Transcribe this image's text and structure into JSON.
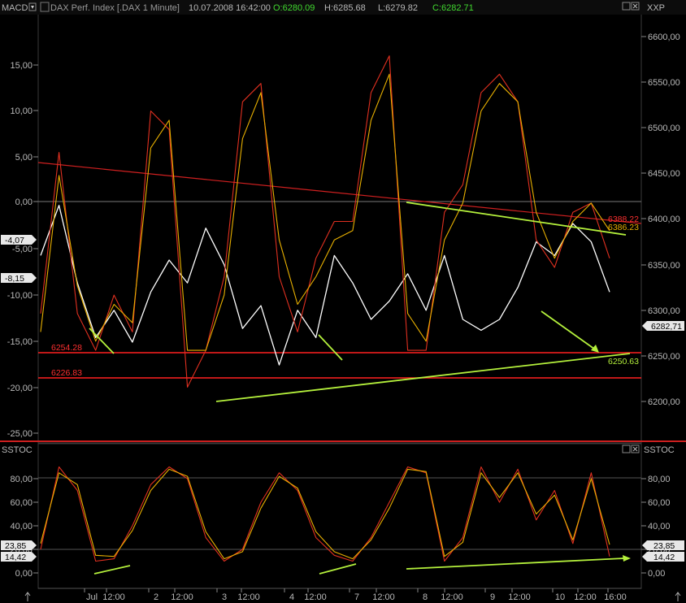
{
  "main_panel": {
    "left_title": "MACD",
    "right_title": "XXP",
    "instrument": "DAX Perf. Index [.DAX  1 Minute]",
    "datetime": "10.07.2008 16:42:00",
    "open": "O:6280.09",
    "high": "H:6285.68",
    "low": "L:6279.82",
    "close": "C:6282.71",
    "left_axis_ticks": [
      "15,00",
      "10,00",
      "5,00",
      "0,00",
      "-5,00",
      "-10,00",
      "-15,00",
      "-20,00",
      "-25,00"
    ],
    "right_axis_ticks": [
      "6600,00",
      "6550,00",
      "6500,00",
      "6450,00",
      "6400,00",
      "6350,00",
      "6300,00",
      "6250,00",
      "6200,00"
    ],
    "macd_tag_1": "-4,07",
    "macd_tag_2": "-8,15",
    "price_tag": "6282,71",
    "level_1": "6254.28",
    "level_2": "6226.83",
    "resistance_1": "6388.22",
    "resistance_2": "6386.23",
    "support_label": "6250.63"
  },
  "stoch_panel": {
    "left_title": "SSTOC",
    "right_title": "SSTOC",
    "left_axis_ticks": [
      "80,00",
      "60,00",
      "40,00",
      "20,00",
      "0,00"
    ],
    "right_axis_ticks": [
      "80,00",
      "60,00",
      "40,00",
      "20,00",
      "0,00"
    ],
    "value_1": "23,85",
    "value_2": "14,42"
  },
  "x_axis": {
    "labels": [
      "Jul",
      "12:00",
      "2",
      "12:00",
      "3",
      "12:00",
      "4",
      "12:00",
      "7",
      "12:00",
      "8",
      "12:00",
      "9",
      "12:00",
      "10",
      "12:00",
      "16:00"
    ]
  },
  "colors": {
    "background": "#000000",
    "price": "#ffffff",
    "macd": "#e03020",
    "signal": "#e8b000",
    "trend_green": "#b4f03c",
    "level_red": "#ff2020"
  },
  "chart_data": [
    {
      "type": "line",
      "name": "price",
      "x": [
        "07-01 09:00",
        "07-01 12:00",
        "07-01 15:00",
        "07-01 17:30",
        "07-02 09:00",
        "07-02 12:00",
        "07-02 15:00",
        "07-02 17:30",
        "07-03 09:00",
        "07-03 12:00",
        "07-03 15:00",
        "07-03 17:30",
        "07-04 09:00",
        "07-04 12:00",
        "07-04 15:00",
        "07-04 17:30",
        "07-07 09:00",
        "07-07 12:00",
        "07-07 15:00",
        "07-07 17:30",
        "07-08 09:00",
        "07-08 12:00",
        "07-08 15:00",
        "07-08 17:30",
        "07-09 09:00",
        "07-09 12:00",
        "07-09 15:00",
        "07-09 17:30",
        "07-10 09:00",
        "07-10 12:00",
        "07-10 15:00",
        "07-10 16:42"
      ],
      "y": [
        6360,
        6415,
        6330,
        6270,
        6300,
        6265,
        6320,
        6355,
        6330,
        6390,
        6350,
        6280,
        6305,
        6240,
        6300,
        6270,
        6360,
        6330,
        6290,
        6310,
        6340,
        6300,
        6360,
        6290,
        6278,
        6290,
        6325,
        6375,
        6360,
        6395,
        6375,
        6320
      ],
      "ylim": [
        6150,
        6630
      ]
    },
    {
      "type": "line",
      "name": "MACD",
      "series": [
        {
          "name": "MACD",
          "x": [
            "07-01 09:00",
            "07-01 12:00",
            "07-01 15:00",
            "07-01 17:30",
            "07-02 09:00",
            "07-02 12:00",
            "07-02 15:00",
            "07-02 17:30",
            "07-03 09:00",
            "07-03 12:00",
            "07-03 15:00",
            "07-03 17:30",
            "07-04 09:00",
            "07-04 12:00",
            "07-04 15:00",
            "07-04 17:30",
            "07-07 09:00",
            "07-07 12:00",
            "07-07 15:00",
            "07-07 17:30",
            "07-08 09:00",
            "07-08 12:00",
            "07-08 15:00",
            "07-08 17:30",
            "07-09 09:00",
            "07-09 12:00",
            "07-09 15:00",
            "07-09 17:30",
            "07-10 09:00",
            "07-10 12:00",
            "07-10 15:00",
            "07-10 16:42"
          ],
          "y": [
            -12,
            5.5,
            -12,
            -16,
            -10,
            -14,
            10,
            8,
            -20,
            -16,
            -8,
            11,
            13,
            -8,
            -14,
            -6,
            -2,
            -2,
            12,
            16,
            -16,
            -16,
            -1,
            2,
            12,
            14,
            11,
            -4,
            -7,
            -1,
            0,
            -6
          ]
        },
        {
          "name": "Signal",
          "x": [
            "07-01 09:00",
            "07-01 12:00",
            "07-01 15:00",
            "07-01 17:30",
            "07-02 09:00",
            "07-02 12:00",
            "07-02 15:00",
            "07-02 17:30",
            "07-03 09:00",
            "07-03 12:00",
            "07-03 15:00",
            "07-03 17:30",
            "07-04 09:00",
            "07-04 12:00",
            "07-04 15:00",
            "07-04 17:30",
            "07-07 09:00",
            "07-07 12:00",
            "07-07 15:00",
            "07-07 17:30",
            "07-08 09:00",
            "07-08 12:00",
            "07-08 15:00",
            "07-08 17:30",
            "07-09 09:00",
            "07-09 12:00",
            "07-09 15:00",
            "07-09 17:30",
            "07-10 09:00",
            "07-10 12:00",
            "07-10 15:00",
            "07-10 16:42"
          ],
          "y": [
            -14,
            3,
            -9,
            -15,
            -11,
            -13,
            6,
            9,
            -16,
            -16,
            -10,
            7,
            12,
            -4,
            -11,
            -8,
            -4,
            -3,
            9,
            14,
            -12,
            -15,
            -4,
            0,
            10,
            13,
            11,
            -1,
            -6,
            -2,
            0,
            -3
          ]
        }
      ],
      "ylim": [
        -27,
        17
      ]
    },
    {
      "type": "line",
      "name": "SSTOC",
      "series": [
        {
          "name": "%K",
          "x": [
            "07-01 09:00",
            "07-01 12:00",
            "07-01 15:00",
            "07-01 17:30",
            "07-02 09:00",
            "07-02 12:00",
            "07-02 15:00",
            "07-02 17:30",
            "07-03 09:00",
            "07-03 12:00",
            "07-03 15:00",
            "07-03 17:30",
            "07-04 09:00",
            "07-04 12:00",
            "07-04 15:00",
            "07-04 17:30",
            "07-07 09:00",
            "07-07 12:00",
            "07-07 15:00",
            "07-07 17:30",
            "07-08 09:00",
            "07-08 12:00",
            "07-08 15:00",
            "07-08 17:30",
            "07-09 09:00",
            "07-09 12:00",
            "07-09 15:00",
            "07-09 17:30",
            "07-10 09:00",
            "07-10 12:00",
            "07-10 15:00",
            "07-10 16:42"
          ],
          "y": [
            20,
            90,
            70,
            10,
            12,
            40,
            75,
            90,
            80,
            30,
            10,
            20,
            60,
            85,
            70,
            30,
            15,
            10,
            30,
            60,
            90,
            85,
            10,
            30,
            90,
            60,
            88,
            45,
            70,
            25,
            85,
            14
          ]
        },
        {
          "name": "%D",
          "x": [
            "07-01 09:00",
            "07-01 12:00",
            "07-01 15:00",
            "07-01 17:30",
            "07-02 09:00",
            "07-02 12:00",
            "07-02 15:00",
            "07-02 17:30",
            "07-03 09:00",
            "07-03 12:00",
            "07-03 15:00",
            "07-03 17:30",
            "07-04 09:00",
            "07-04 12:00",
            "07-04 15:00",
            "07-04 17:30",
            "07-07 09:00",
            "07-07 12:00",
            "07-07 15:00",
            "07-07 17:30",
            "07-08 09:00",
            "07-08 12:00",
            "07-08 15:00",
            "07-08 17:30",
            "07-09 09:00",
            "07-09 12:00",
            "07-09 15:00",
            "07-09 17:30",
            "07-10 09:00",
            "07-10 12:00",
            "07-10 15:00",
            "07-10 16:42"
          ],
          "y": [
            25,
            85,
            75,
            15,
            14,
            36,
            70,
            88,
            82,
            35,
            12,
            18,
            55,
            82,
            72,
            35,
            18,
            12,
            28,
            55,
            88,
            86,
            14,
            26,
            85,
            64,
            85,
            50,
            66,
            28,
            80,
            24
          ]
        }
      ],
      "ylim": [
        -8,
        100
      ]
    }
  ]
}
